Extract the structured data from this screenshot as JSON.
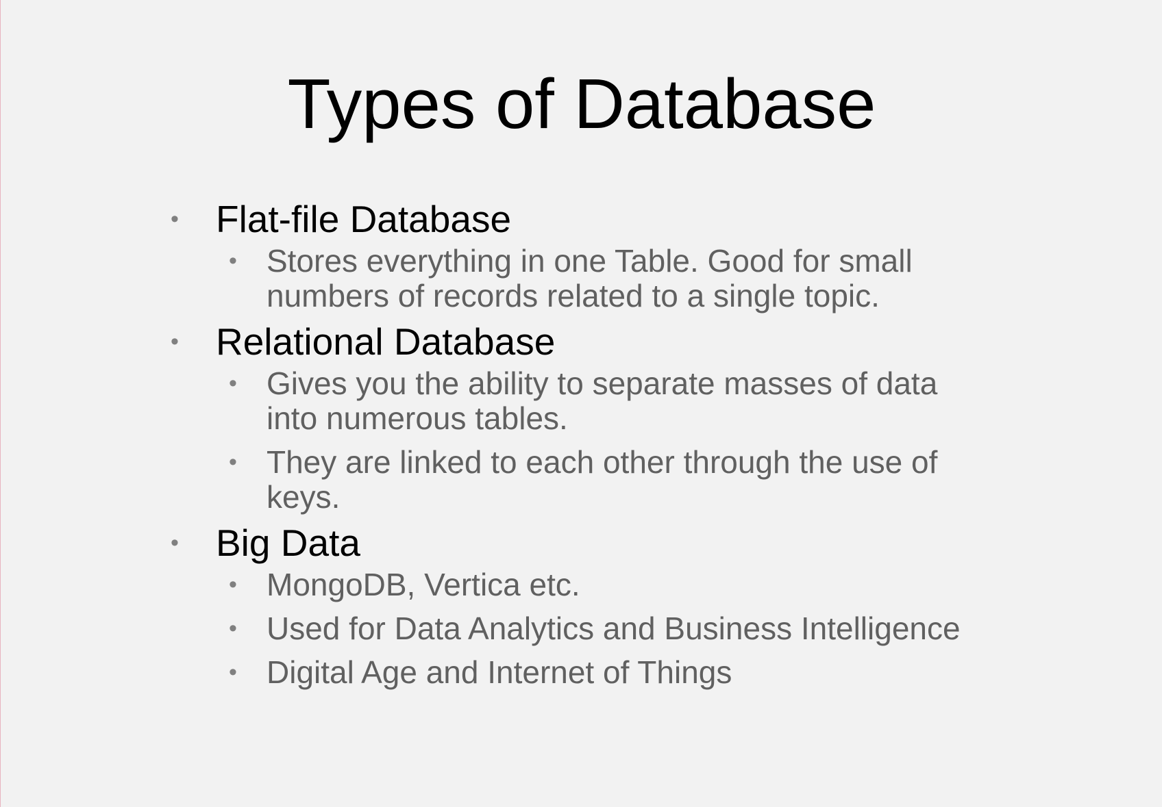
{
  "slide": {
    "title": "Types of Database",
    "bullet_glyph": "•",
    "items": [
      {
        "label": "Flat-file Database",
        "subitems": [
          {
            "line1": "Stores everything in one Table. Good for small",
            "line2": "numbers of records related to a single topic."
          }
        ]
      },
      {
        "label": "Relational Database",
        "subitems": [
          {
            "line1": "Gives you the ability to separate masses of data",
            "line2": "into numerous tables."
          },
          {
            "line1": "They are linked to each other through the use of",
            "line2": "keys."
          }
        ]
      },
      {
        "label": "Big Data",
        "subitems": [
          {
            "line1": "MongoDB, Vertica etc."
          },
          {
            "line1": "Used for Data Analytics and Business Intelligence"
          },
          {
            "line1": "Digital Age and Internet of Things"
          }
        ]
      }
    ]
  },
  "colors": {
    "background": "#f2f2f2",
    "title_text": "#000000",
    "level1_text": "#000000",
    "level2_text": "#606060",
    "bullet": "#808080"
  }
}
